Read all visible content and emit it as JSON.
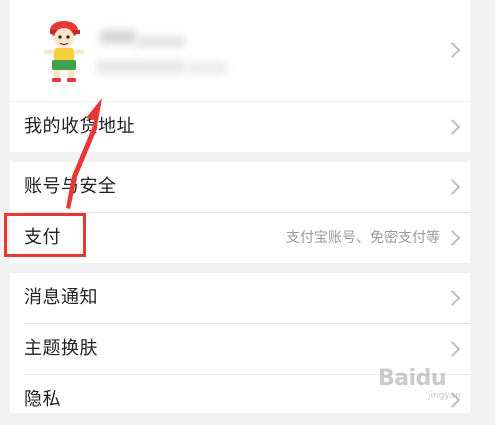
{
  "profile": {
    "name_label": "",
    "chevron": "chevron-right-icon"
  },
  "menu_group_1": {
    "items": [
      {
        "label": "我的收货地址"
      }
    ]
  },
  "menu_group_2": {
    "items": [
      {
        "label": "账号与安全"
      },
      {
        "label": "支付",
        "hint": "支付宝账号、免密支付等"
      }
    ]
  },
  "menu_group_3": {
    "items": [
      {
        "label": "消息通知"
      },
      {
        "label": "主题换肤"
      },
      {
        "label": "隐私"
      }
    ]
  },
  "watermark": {
    "text": "Baidu",
    "sub": "jingyan"
  },
  "colors": {
    "highlight": "#e53935",
    "arrow": "#e53935",
    "background": "#f2f2f2",
    "panel": "#ffffff"
  }
}
